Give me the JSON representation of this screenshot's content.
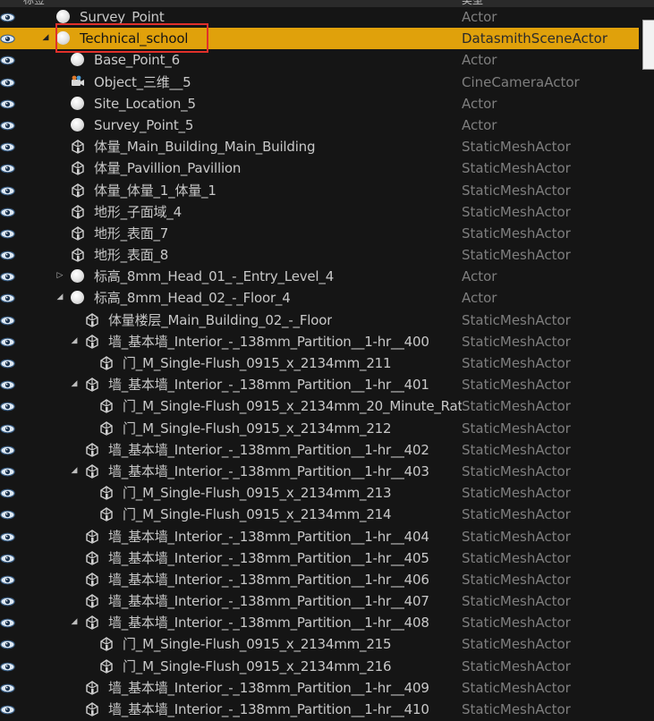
{
  "header": {
    "col_label": "标签",
    "col_type": "类型"
  },
  "rows": [
    {
      "label": "Survey_Point",
      "type": "Actor",
      "indent": 0,
      "icon": "sphere-icon",
      "arrow": ""
    },
    {
      "label": "Technical_school",
      "type": "DatasmithSceneActor",
      "indent": 0,
      "icon": "sphere-icon",
      "arrow": "down",
      "selected": true
    },
    {
      "label": "Base_Point_6",
      "type": "Actor",
      "indent": 1,
      "icon": "sphere-icon",
      "arrow": ""
    },
    {
      "label": "Object_三维__5",
      "type": "CineCameraActor",
      "indent": 1,
      "icon": "camera-icon",
      "arrow": ""
    },
    {
      "label": "Site_Location_5",
      "type": "Actor",
      "indent": 1,
      "icon": "sphere-icon",
      "arrow": ""
    },
    {
      "label": "Survey_Point_5",
      "type": "Actor",
      "indent": 1,
      "icon": "sphere-icon",
      "arrow": ""
    },
    {
      "label": "体量_Main_Building_Main_Building",
      "type": "StaticMeshActor",
      "indent": 1,
      "icon": "static-mesh-icon",
      "arrow": ""
    },
    {
      "label": "体量_Pavillion_Pavillion",
      "type": "StaticMeshActor",
      "indent": 1,
      "icon": "static-mesh-icon",
      "arrow": ""
    },
    {
      "label": "体量_体量_1_体量_1",
      "type": "StaticMeshActor",
      "indent": 1,
      "icon": "static-mesh-icon",
      "arrow": ""
    },
    {
      "label": "地形_子面域_4",
      "type": "StaticMeshActor",
      "indent": 1,
      "icon": "static-mesh-icon",
      "arrow": ""
    },
    {
      "label": "地形_表面_7",
      "type": "StaticMeshActor",
      "indent": 1,
      "icon": "static-mesh-icon",
      "arrow": ""
    },
    {
      "label": "地形_表面_8",
      "type": "StaticMeshActor",
      "indent": 1,
      "icon": "static-mesh-icon",
      "arrow": ""
    },
    {
      "label": "标高_8mm_Head_01_-_Entry_Level_4",
      "type": "Actor",
      "indent": 1,
      "icon": "sphere-icon",
      "arrow": "right"
    },
    {
      "label": "标高_8mm_Head_02_-_Floor_4",
      "type": "Actor",
      "indent": 1,
      "icon": "sphere-icon",
      "arrow": "down"
    },
    {
      "label": "体量楼层_Main_Building_02_-_Floor",
      "type": "StaticMeshActor",
      "indent": 2,
      "icon": "static-mesh-icon",
      "arrow": ""
    },
    {
      "label": "墙_基本墙_Interior_-_138mm_Partition__1-hr__400",
      "type": "StaticMeshActor",
      "indent": 2,
      "icon": "static-mesh-icon",
      "arrow": "down"
    },
    {
      "label": "门_M_Single-Flush_0915_x_2134mm_211",
      "type": "StaticMeshActor",
      "indent": 3,
      "icon": "static-mesh-icon",
      "arrow": ""
    },
    {
      "label": "墙_基本墙_Interior_-_138mm_Partition__1-hr__401",
      "type": "StaticMeshActor",
      "indent": 2,
      "icon": "static-mesh-icon",
      "arrow": "down"
    },
    {
      "label": "门_M_Single-Flush_0915_x_2134mm_20_Minute_Rat",
      "type": "StaticMeshActor",
      "indent": 3,
      "icon": "static-mesh-icon",
      "arrow": ""
    },
    {
      "label": "门_M_Single-Flush_0915_x_2134mm_212",
      "type": "StaticMeshActor",
      "indent": 3,
      "icon": "static-mesh-icon",
      "arrow": ""
    },
    {
      "label": "墙_基本墙_Interior_-_138mm_Partition__1-hr__402",
      "type": "StaticMeshActor",
      "indent": 2,
      "icon": "static-mesh-icon",
      "arrow": ""
    },
    {
      "label": "墙_基本墙_Interior_-_138mm_Partition__1-hr__403",
      "type": "StaticMeshActor",
      "indent": 2,
      "icon": "static-mesh-icon",
      "arrow": "down"
    },
    {
      "label": "门_M_Single-Flush_0915_x_2134mm_213",
      "type": "StaticMeshActor",
      "indent": 3,
      "icon": "static-mesh-icon",
      "arrow": ""
    },
    {
      "label": "门_M_Single-Flush_0915_x_2134mm_214",
      "type": "StaticMeshActor",
      "indent": 3,
      "icon": "static-mesh-icon",
      "arrow": ""
    },
    {
      "label": "墙_基本墙_Interior_-_138mm_Partition__1-hr__404",
      "type": "StaticMeshActor",
      "indent": 2,
      "icon": "static-mesh-icon",
      "arrow": ""
    },
    {
      "label": "墙_基本墙_Interior_-_138mm_Partition__1-hr__405",
      "type": "StaticMeshActor",
      "indent": 2,
      "icon": "static-mesh-icon",
      "arrow": ""
    },
    {
      "label": "墙_基本墙_Interior_-_138mm_Partition__1-hr__406",
      "type": "StaticMeshActor",
      "indent": 2,
      "icon": "static-mesh-icon",
      "arrow": ""
    },
    {
      "label": "墙_基本墙_Interior_-_138mm_Partition__1-hr__407",
      "type": "StaticMeshActor",
      "indent": 2,
      "icon": "static-mesh-icon",
      "arrow": ""
    },
    {
      "label": "墙_基本墙_Interior_-_138mm_Partition__1-hr__408",
      "type": "StaticMeshActor",
      "indent": 2,
      "icon": "static-mesh-icon",
      "arrow": "down"
    },
    {
      "label": "门_M_Single-Flush_0915_x_2134mm_215",
      "type": "StaticMeshActor",
      "indent": 3,
      "icon": "static-mesh-icon",
      "arrow": ""
    },
    {
      "label": "门_M_Single-Flush_0915_x_2134mm_216",
      "type": "StaticMeshActor",
      "indent": 3,
      "icon": "static-mesh-icon",
      "arrow": ""
    },
    {
      "label": "墙_基本墙_Interior_-_138mm_Partition__1-hr__409",
      "type": "StaticMeshActor",
      "indent": 2,
      "icon": "static-mesh-icon",
      "arrow": ""
    },
    {
      "label": "墙_基本墙_Interior_-_138mm_Partition__1-hr__410",
      "type": "StaticMeshActor",
      "indent": 2,
      "icon": "static-mesh-icon",
      "arrow": ""
    }
  ],
  "colors": {
    "selection": "#e0a10b",
    "highlight_box": "#e0302a",
    "type_text": "#7e7e7e",
    "label_text": "#c8c8c8",
    "eye_icon": "#6fa8dc"
  }
}
